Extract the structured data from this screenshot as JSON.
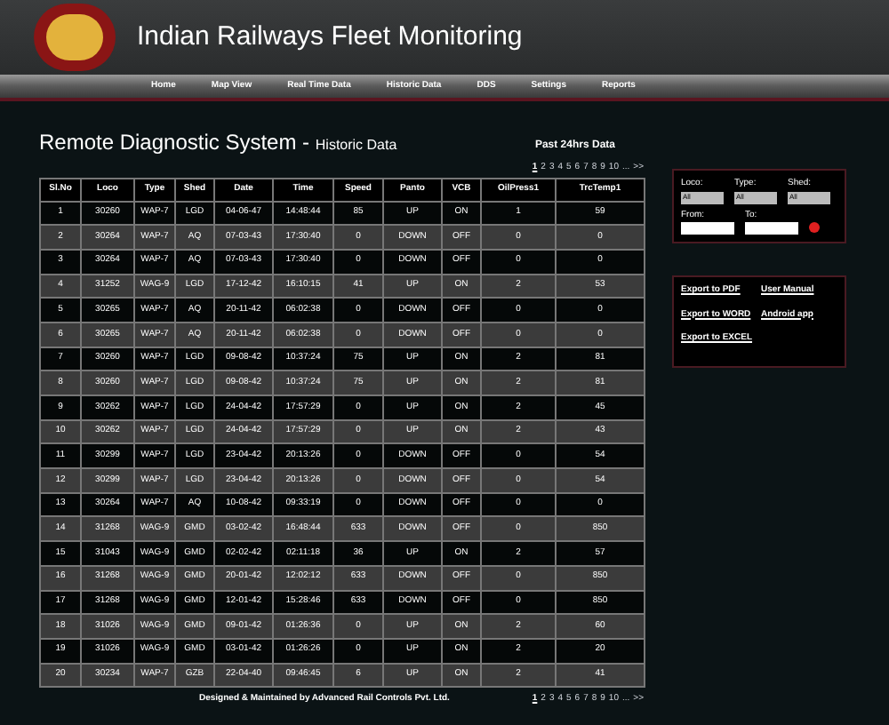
{
  "header": {
    "title": "Indian Railways Fleet Monitoring"
  },
  "nav": [
    {
      "label": "Home"
    },
    {
      "label": "Map View"
    },
    {
      "label": "Real Time Data"
    },
    {
      "label": "Historic Data"
    },
    {
      "label": "DDS"
    },
    {
      "label": "Settings"
    },
    {
      "label": "Reports"
    }
  ],
  "page": {
    "title": "Remote Diagnostic System - ",
    "subtitle": "Historic Data",
    "past_link": "Past 24hrs Data"
  },
  "pagination_top": [
    {
      "label": "1",
      "selected": true
    },
    {
      "label": "2",
      "selected": false
    },
    {
      "label": "3",
      "selected": false
    },
    {
      "label": "4",
      "selected": false
    },
    {
      "label": "5",
      "selected": false
    },
    {
      "label": "6",
      "selected": false
    },
    {
      "label": "7",
      "selected": false
    },
    {
      "label": "8",
      "selected": false
    },
    {
      "label": "9",
      "selected": false
    },
    {
      "label": "10",
      "selected": false
    },
    {
      "label": "...",
      "selected": false
    },
    {
      "label": ">>",
      "selected": false
    }
  ],
  "table": {
    "columns": [
      "Sl.No",
      "Loco",
      "Type",
      "Shed",
      "Date",
      "Time",
      "Speed",
      "Panto",
      "VCB",
      "OilPress1",
      "TrcTemp1"
    ],
    "rows": [
      [
        "1",
        "30260",
        "WAP-7",
        "LGD",
        "04-06-47",
        "14:48:44",
        "85",
        "UP",
        "ON",
        "1",
        "59"
      ],
      [
        "2",
        "30264",
        "WAP-7",
        "AQ",
        "07-03-43",
        "17:30:40",
        "0",
        "DOWN",
        "OFF",
        "0",
        "0"
      ],
      [
        "3",
        "30264",
        "WAP-7",
        "AQ",
        "07-03-43",
        "17:30:40",
        "0",
        "DOWN",
        "OFF",
        "0",
        "0"
      ],
      [
        "4",
        "31252",
        "WAG-9",
        "LGD",
        "17-12-42",
        "16:10:15",
        "41",
        "UP",
        "ON",
        "2",
        "53"
      ],
      [
        "5",
        "30265",
        "WAP-7",
        "AQ",
        "20-11-42",
        "06:02:38",
        "0",
        "DOWN",
        "OFF",
        "0",
        "0"
      ],
      [
        "6",
        "30265",
        "WAP-7",
        "AQ",
        "20-11-42",
        "06:02:38",
        "0",
        "DOWN",
        "OFF",
        "0",
        "0"
      ],
      [
        "7",
        "30260",
        "WAP-7",
        "LGD",
        "09-08-42",
        "10:37:24",
        "75",
        "UP",
        "ON",
        "2",
        "81"
      ],
      [
        "8",
        "30260",
        "WAP-7",
        "LGD",
        "09-08-42",
        "10:37:24",
        "75",
        "UP",
        "ON",
        "2",
        "81"
      ],
      [
        "9",
        "30262",
        "WAP-7",
        "LGD",
        "24-04-42",
        "17:57:29",
        "0",
        "UP",
        "ON",
        "2",
        "45"
      ],
      [
        "10",
        "30262",
        "WAP-7",
        "LGD",
        "24-04-42",
        "17:57:29",
        "0",
        "UP",
        "ON",
        "2",
        "43"
      ],
      [
        "11",
        "30299",
        "WAP-7",
        "LGD",
        "23-04-42",
        "20:13:26",
        "0",
        "DOWN",
        "OFF",
        "0",
        "54"
      ],
      [
        "12",
        "30299",
        "WAP-7",
        "LGD",
        "23-04-42",
        "20:13:26",
        "0",
        "DOWN",
        "OFF",
        "0",
        "54"
      ],
      [
        "13",
        "30264",
        "WAP-7",
        "AQ",
        "10-08-42",
        "09:33:19",
        "0",
        "DOWN",
        "OFF",
        "0",
        "0"
      ],
      [
        "14",
        "31268",
        "WAG-9",
        "GMD",
        "03-02-42",
        "16:48:44",
        "633",
        "DOWN",
        "OFF",
        "0",
        "850"
      ],
      [
        "15",
        "31043",
        "WAG-9",
        "GMD",
        "02-02-42",
        "02:11:18",
        "36",
        "UP",
        "ON",
        "2",
        "57"
      ],
      [
        "16",
        "31268",
        "WAG-9",
        "GMD",
        "20-01-42",
        "12:02:12",
        "633",
        "DOWN",
        "OFF",
        "0",
        "850"
      ],
      [
        "17",
        "31268",
        "WAG-9",
        "GMD",
        "12-01-42",
        "15:28:46",
        "633",
        "DOWN",
        "OFF",
        "0",
        "850"
      ],
      [
        "18",
        "31026",
        "WAG-9",
        "GMD",
        "09-01-42",
        "01:26:36",
        "0",
        "UP",
        "ON",
        "2",
        "60"
      ],
      [
        "19",
        "31026",
        "WAG-9",
        "GMD",
        "03-01-42",
        "01:26:26",
        "0",
        "UP",
        "ON",
        "2",
        "20"
      ],
      [
        "20",
        "30234",
        "WAP-7",
        "GZB",
        "22-04-40",
        "09:46:45",
        "6",
        "UP",
        "ON",
        "2",
        "41"
      ]
    ]
  },
  "pagination_bottom": [
    {
      "label": "1",
      "selected": true
    },
    {
      "label": "2",
      "selected": false
    },
    {
      "label": "3",
      "selected": false
    },
    {
      "label": "4",
      "selected": false
    },
    {
      "label": "5",
      "selected": false
    },
    {
      "label": "6",
      "selected": false
    },
    {
      "label": "7",
      "selected": false
    },
    {
      "label": "8",
      "selected": false
    },
    {
      "label": "9",
      "selected": false
    },
    {
      "label": "10",
      "selected": false
    },
    {
      "label": "...",
      "selected": false
    },
    {
      "label": ">>",
      "selected": false
    }
  ],
  "footer": "Designed & Maintained by Advanced Rail Controls Pvt. Ltd.",
  "filters": {
    "selects": [
      {
        "label": "Loco:",
        "value": "All"
      },
      {
        "label": "Type:",
        "value": "All"
      },
      {
        "label": "Shed:",
        "value": "All"
      }
    ],
    "dates": [
      {
        "label": "From:"
      },
      {
        "label": "To:"
      }
    ]
  },
  "links": [
    {
      "label": "Export to PDF"
    },
    {
      "label": "User Manual"
    },
    {
      "label": "Export to WORD"
    },
    {
      "label": "Android app"
    },
    {
      "label": "Export to EXCEL"
    }
  ]
}
